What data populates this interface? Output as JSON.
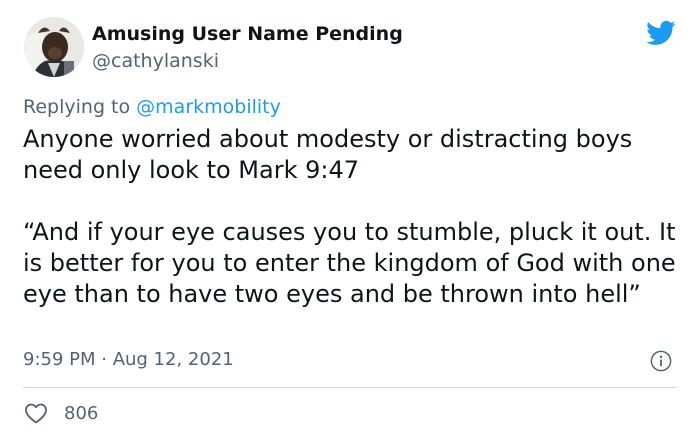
{
  "author": {
    "display_name": "Amusing User Name Pending",
    "handle": "@cathylanski",
    "avatar_icon": "avatar-photo"
  },
  "brand": {
    "icon": "twitter-bird-icon",
    "color": "#1d9bf0"
  },
  "reply": {
    "prefix": "Replying to",
    "mention": "@markmobility"
  },
  "tweet": {
    "paragraph_1": "Anyone worried about modesty or distracting boys need only look to Mark 9:47",
    "paragraph_2": "“And if your eye causes you to stumble, pluck it out. It is better for you to enter the kingdom of God with one eye than to have two eyes and be thrown into hell”",
    "timestamp": "9:59 PM · Aug 12, 2021"
  },
  "actions": {
    "info_icon": "info-icon",
    "like_icon": "heart-icon",
    "like_count": "806"
  },
  "colors": {
    "text": "#0f1419",
    "secondary": "#536471",
    "link": "#1d9bf0",
    "divider": "#cfd9de"
  }
}
